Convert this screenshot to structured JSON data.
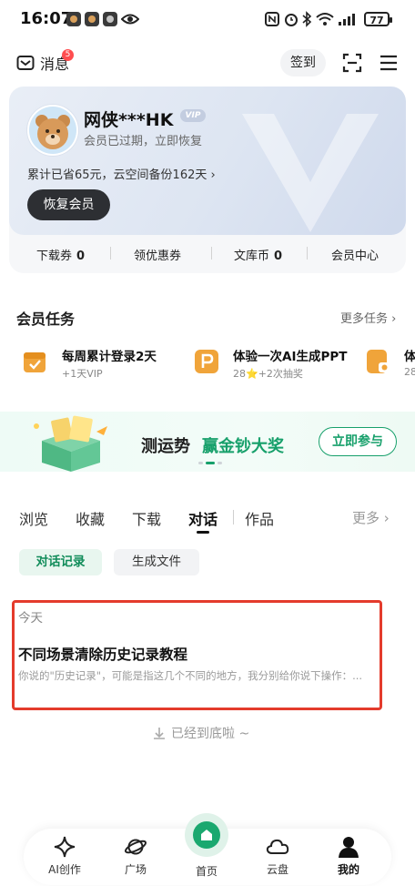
{
  "status_bar": {
    "time": "16:07",
    "battery": "77"
  },
  "top_bar": {
    "messages_label": "消息",
    "messages_badge": "5",
    "checkin_label": "签到"
  },
  "member_card": {
    "username": "网侠***HK",
    "vip_tag": "VIP",
    "expired_text": "会员已过期，立即恢复",
    "saved_text": "累计已省65元，云空间备份162天",
    "renew_button": "恢复会员",
    "stats": [
      {
        "label": "下载券",
        "value": "0"
      },
      {
        "label": "领优惠券",
        "value": ""
      },
      {
        "label": "文库币",
        "value": "0"
      },
      {
        "label": "会员中心",
        "value": ""
      }
    ]
  },
  "tasks": {
    "title": "会员任务",
    "more_label": "更多任务",
    "items": [
      {
        "title": "每周累计登录2天",
        "sub": "+1天VIP"
      },
      {
        "title": "体验一次AI生成PPT",
        "sub": "28⭐+2次抽奖"
      },
      {
        "title": "体",
        "sub": "28"
      }
    ]
  },
  "banner": {
    "text_dark": "测运势",
    "text_green": "赢金钞大奖",
    "cta": "立即参与"
  },
  "tabs": {
    "items": [
      "浏览",
      "收藏",
      "下载",
      "对话",
      "作品"
    ],
    "active": "对话",
    "more_label": "更多"
  },
  "chips": {
    "active": "对话记录",
    "inactive": "生成文件"
  },
  "conversations": {
    "group_label": "今天",
    "items": [
      {
        "title": "不同场景清除历史记录教程",
        "preview": "你说的\"历史记录\"，可能是指这几个不同的地方，我分别给你说下操作：..."
      }
    ],
    "end_text": "已经到底啦 ~"
  },
  "bottom_nav": {
    "items": [
      "AI创作",
      "广场",
      "首页",
      "云盘",
      "我的"
    ],
    "active": "我的"
  },
  "colors": {
    "accent_green": "#17a06b",
    "highlight_red": "#e43b2c"
  }
}
